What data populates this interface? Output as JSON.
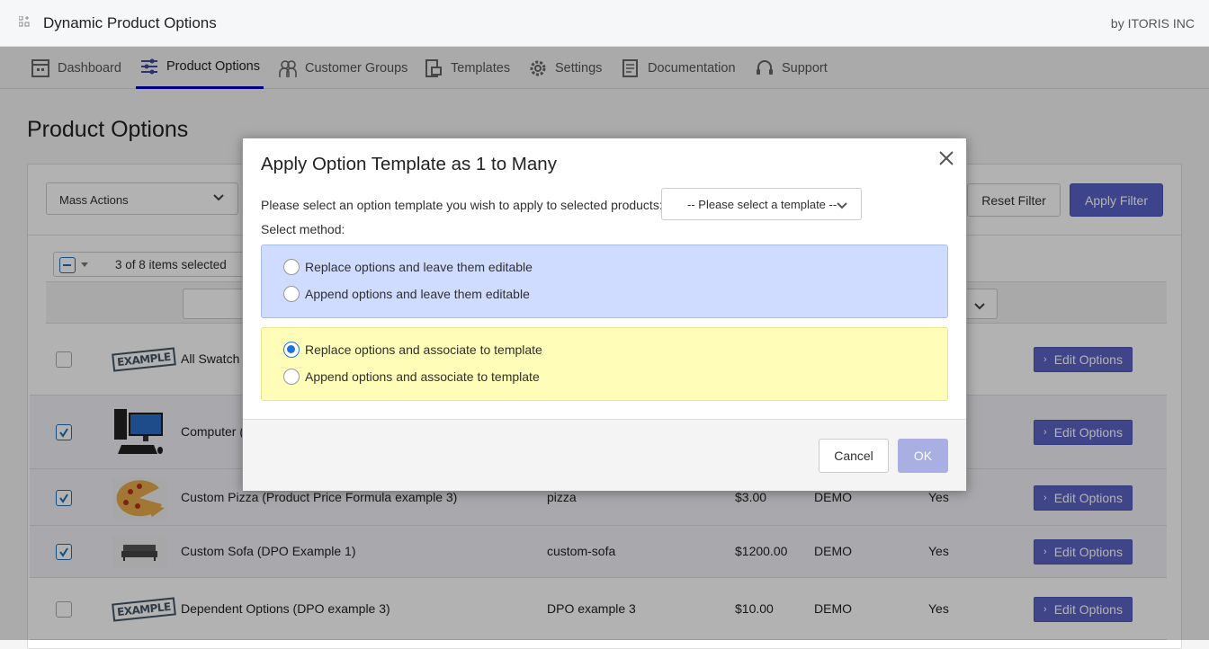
{
  "app": {
    "title": "Dynamic Product Options",
    "vendor": "by ITORIS INC"
  },
  "nav": [
    {
      "label": "Dashboard",
      "icon": "dashboard-icon"
    },
    {
      "label": "Product Options",
      "icon": "sliders-icon",
      "active": true
    },
    {
      "label": "Customer Groups",
      "icon": "users-icon"
    },
    {
      "label": "Templates",
      "icon": "templates-icon"
    },
    {
      "label": "Settings",
      "icon": "gear-icon"
    },
    {
      "label": "Documentation",
      "icon": "document-icon"
    },
    {
      "label": "Support",
      "icon": "headset-icon"
    }
  ],
  "page": {
    "title": "Product Options"
  },
  "toolbar": {
    "mass_actions": "Mass Actions",
    "reset_filter": "Reset Filter",
    "apply_filter": "Apply Filter",
    "selection": "3 of 8 items selected"
  },
  "rows": [
    {
      "name": "All Swatch T",
      "sku": "",
      "price": "",
      "website": "",
      "active": "",
      "checked": false,
      "image": "example-stamp",
      "action": "Edit Options"
    },
    {
      "name": "Computer (",
      "sku": "",
      "price": "",
      "website": "",
      "active": "",
      "checked": true,
      "image": "computer",
      "action": "Edit Options"
    },
    {
      "name": "Custom Pizza (Product Price Formula example 3)",
      "sku": "pizza",
      "price": "$3.00",
      "website": "DEMO",
      "active": "Yes",
      "checked": true,
      "image": "pizza",
      "action": "Edit Options"
    },
    {
      "name": "Custom Sofa (DPO Example 1)",
      "sku": "custom-sofa",
      "price": "$1200.00",
      "website": "DEMO",
      "active": "Yes",
      "checked": true,
      "image": "sofa",
      "action": "Edit Options"
    },
    {
      "name": "Dependent Options (DPO example 3)",
      "sku": "DPO example 3",
      "price": "$10.00",
      "website": "DEMO",
      "active": "Yes",
      "checked": false,
      "image": "example-stamp",
      "action": "Edit Options"
    }
  ],
  "stamp_text": "EXAMPLE",
  "dialog": {
    "title": "Apply Option Template as 1 to Many",
    "prompt": "Please select an option template you wish to apply to selected products:",
    "template_select": "-- Please select a template --",
    "method_label": "Select method:",
    "options": [
      {
        "label": "Replace options and leave them editable",
        "selected": false
      },
      {
        "label": "Append options and leave them editable",
        "selected": false
      },
      {
        "label": "Replace options and associate to template",
        "selected": true
      },
      {
        "label": "Append options and associate to template",
        "selected": false
      }
    ],
    "cancel": "Cancel",
    "ok": "OK"
  },
  "colors": {
    "accent": "#5862c8",
    "radio": "#1e73d6",
    "editable_group": "#cfdcff",
    "associate_group": "#fffdb8",
    "active_tab": "#0000c0"
  }
}
